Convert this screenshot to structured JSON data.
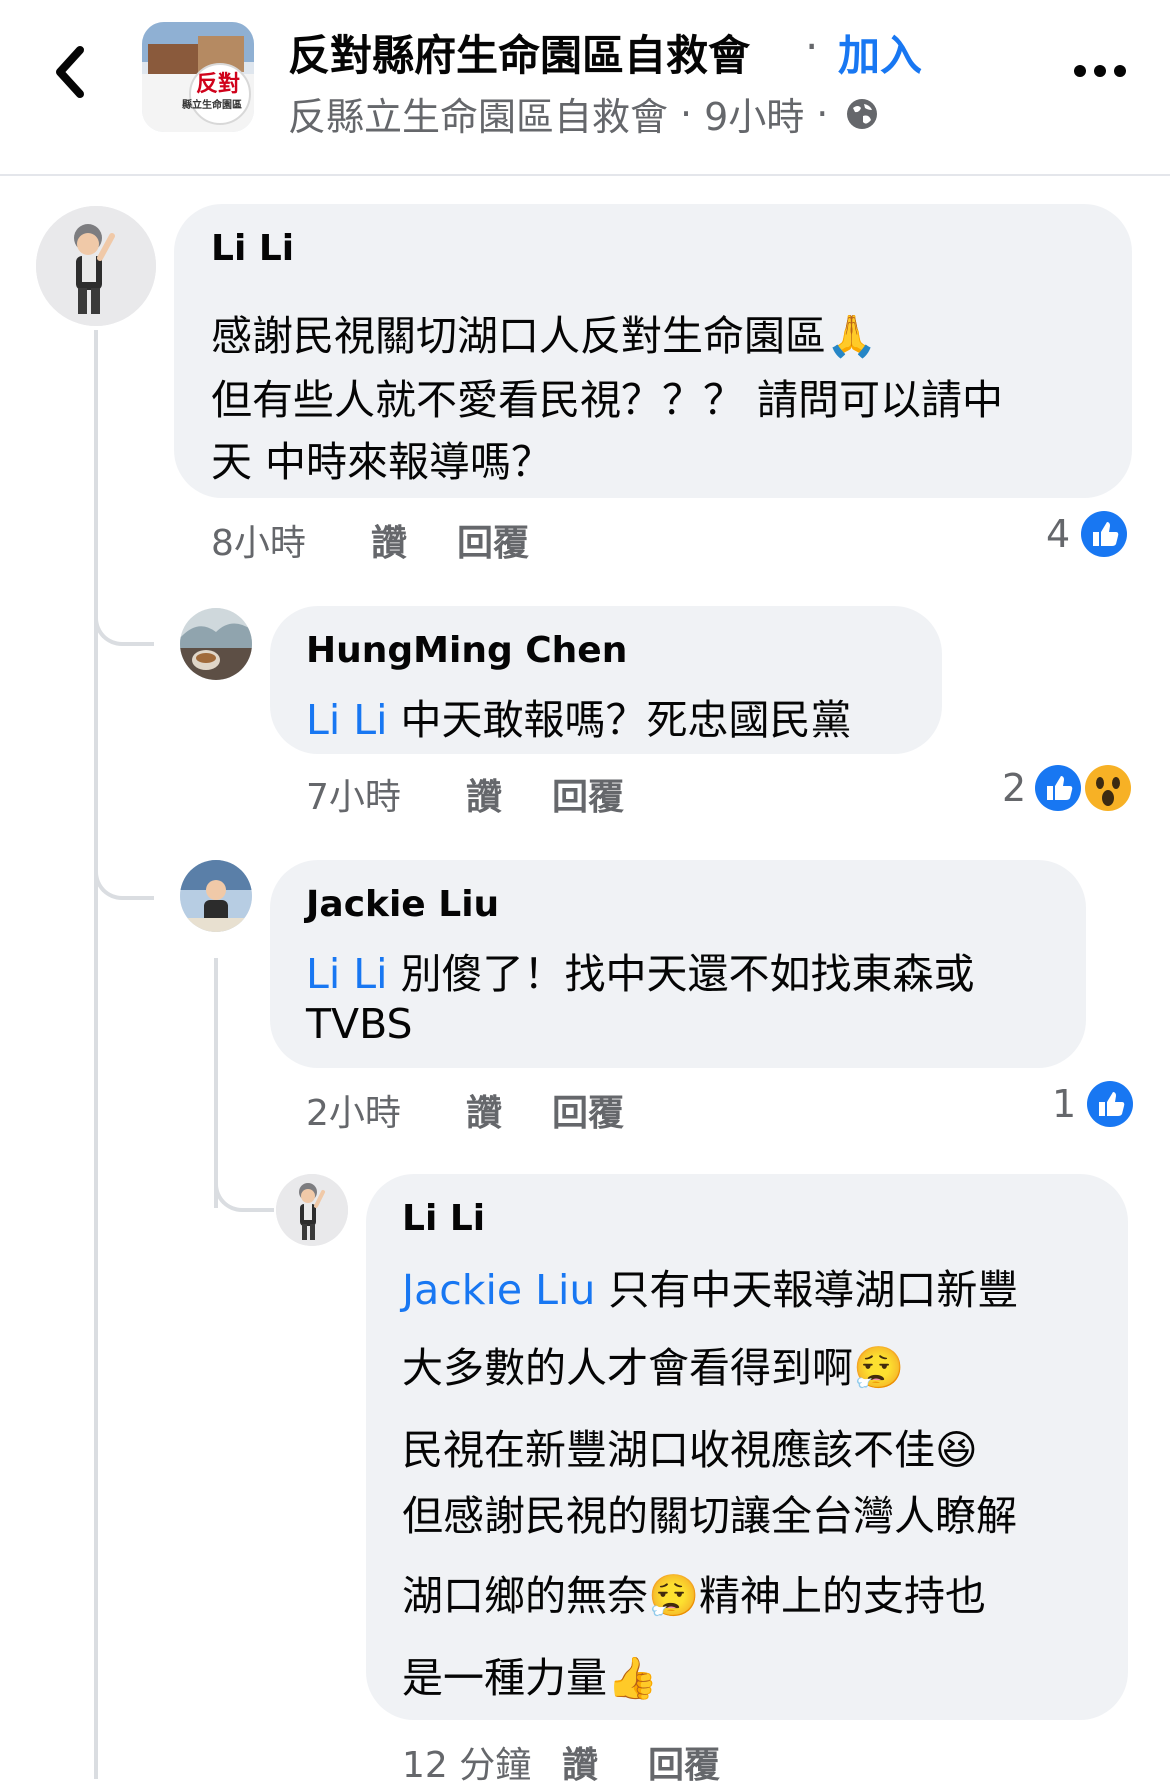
{
  "header": {
    "group_name": "反對縣府生命園區自救會",
    "join_separator": "·",
    "join_label": "加入",
    "author": "反縣立生命園區自救會",
    "time": "9小時",
    "dot": "·",
    "avatar_text_main": "反對",
    "avatar_text_sub": "縣立生命園區",
    "icons": {
      "back": "chevron-left-icon",
      "globe": "globe-icon",
      "more": "more-horizontal-icon"
    }
  },
  "comments": [
    {
      "author": "Li Li",
      "lines": [
        "感謝民視關切湖口人反對生命園區🙏",
        "但有些人就不愛看民視？？？ 請問可以請中",
        "天 中時來報導嗎？"
      ],
      "time": "8小時",
      "like_label": "讚",
      "reply_label": "回覆",
      "reaction_count": "4",
      "reactions": [
        "like"
      ]
    },
    {
      "author": "HungMing Chen",
      "mention": "Li Li",
      "lines": [
        " 中天敢報嗎？死忠國民黨"
      ],
      "time": "7小時",
      "like_label": "讚",
      "reply_label": "回覆",
      "reaction_count": "2",
      "reactions": [
        "like",
        "wow"
      ]
    },
    {
      "author": "Jackie Liu",
      "mention": "Li Li",
      "lines": [
        " 別傻了！找中天還不如找東森或",
        "TVBS"
      ],
      "time": "2小時",
      "like_label": "讚",
      "reply_label": "回覆",
      "reaction_count": "1",
      "reactions": [
        "like"
      ]
    },
    {
      "author": "Li Li",
      "mention": "Jackie Liu",
      "lines": [
        " 只有中天報導湖口新豐",
        "大多數的人才會看得到啊😮‍💨",
        "民視在新豐湖口收視應該不佳😆",
        "但感謝民視的關切讓全台灣人瞭解",
        "湖口鄉的無奈😮‍💨精神上的支持也",
        "是一種力量👍"
      ],
      "time": "12 分鐘",
      "like_label": "讚",
      "reply_label": "回覆"
    }
  ],
  "colors": {
    "accent": "#1877f2",
    "bubble": "#f0f2f5",
    "meta": "#65676b",
    "like": "#1877f2",
    "wow": "#f7b125"
  }
}
